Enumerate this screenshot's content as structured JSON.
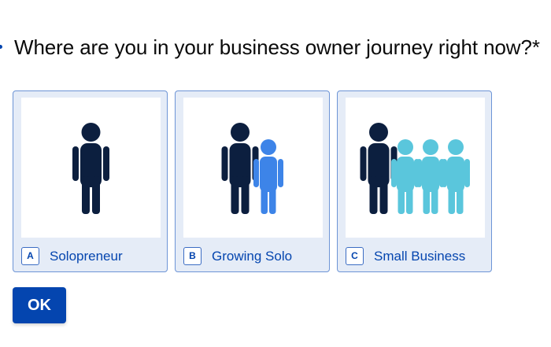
{
  "question": {
    "text": "Where are you in your business owner journey right now?*"
  },
  "options": [
    {
      "key": "A",
      "label": "Solopreneur",
      "image_icon": "single-person-icon"
    },
    {
      "key": "B",
      "label": "Growing Solo",
      "image_icon": "two-people-icon"
    },
    {
      "key": "C",
      "label": "Small Business",
      "image_icon": "group-people-icon"
    }
  ],
  "submit": {
    "label": "OK"
  },
  "colors": {
    "accent": "#0445af",
    "option_bg": "#e5ecf7",
    "option_border": "#6d94d6",
    "person_dark": "#0c1f3f",
    "person_blue": "#3d84e8",
    "person_teal": "#5ac6dc"
  }
}
